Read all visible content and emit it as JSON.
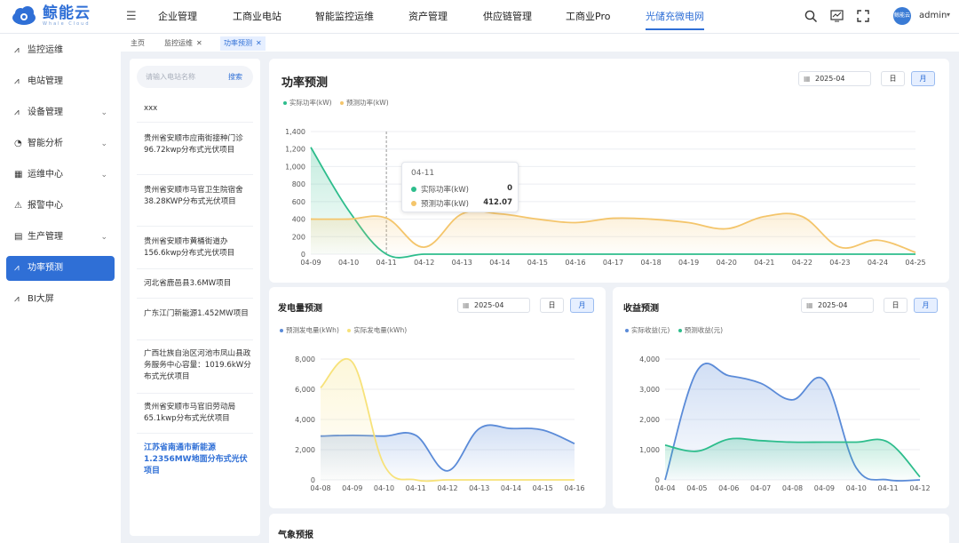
{
  "app": {
    "logo_text": "鲸能云",
    "logo_sub": "Whale Cloud"
  },
  "nav": {
    "items": [
      "企业管理",
      "工商业电站",
      "智能监控运维",
      "资产管理",
      "供应链管理",
      "工商业Pro",
      "光储充微电网"
    ],
    "active_index": 6
  },
  "header": {
    "user": "admin",
    "avatar_text": "鲸能云"
  },
  "sidebar": {
    "items": [
      {
        "label": "监控运维",
        "icon": "chart-line-icon",
        "expandable": false
      },
      {
        "label": "电站管理",
        "icon": "chart-line-icon",
        "expandable": false
      },
      {
        "label": "设备管理",
        "icon": "chart-line-icon",
        "expandable": true
      },
      {
        "label": "智能分析",
        "icon": "pie-chart-icon",
        "expandable": true
      },
      {
        "label": "运维中心",
        "icon": "grid-icon",
        "expandable": true
      },
      {
        "label": "报警中心",
        "icon": "warning-icon",
        "expandable": false
      },
      {
        "label": "生产管理",
        "icon": "calendar-icon",
        "expandable": true
      },
      {
        "label": "功率预测",
        "icon": "chart-line-icon",
        "expandable": false
      },
      {
        "label": "BI大屏",
        "icon": "chart-line-icon",
        "expandable": false
      }
    ],
    "active_index": 7
  },
  "tabs": [
    {
      "label": "主页",
      "closable": false
    },
    {
      "label": "监控运维",
      "closable": true
    },
    {
      "label": "功率预测",
      "closable": true,
      "active": true
    }
  ],
  "search": {
    "placeholder": "请输入电站名称",
    "button": "搜索",
    "value": ""
  },
  "stations": [
    "xxx",
    "贵州省安顺市应南街接种门诊96.72kwp分布式光伏项目",
    "贵州省安顺市马官卫生院宿舍38.28KWP分布式光伏项目",
    "贵州省安顺市黄桶街道办156.6kwp分布式光伏项目",
    "河北省鹿邑县3.6MW项目",
    "广东江门新能源1.452MW项目",
    "广西壮族自治区河池市凤山县政务服务中心容量：1019.6kW分布式光伏项目",
    "贵州省安顺市马官旧劳动局65.1kwp分布式光伏项目",
    "江苏省南通市新能源1.2356MW地面分布式光伏项目"
  ],
  "selected_station_index": 8,
  "toggle": {
    "day": "日",
    "month": "月"
  },
  "power_card": {
    "title": "功率预测",
    "date": "2025-04",
    "legend": [
      "实际功率(kW)",
      "预测功率(kW)"
    ],
    "tooltip": {
      "date": "04-11",
      "rows": [
        {
          "label": "实际功率(kW)",
          "value": "0"
        },
        {
          "label": "预测功率(kW)",
          "value": "412.07"
        }
      ]
    }
  },
  "gen_card": {
    "title": "发电量预测",
    "date": "2025-04",
    "legend": [
      "预测发电量(kWh)",
      "实际发电量(kWh)"
    ]
  },
  "rev_card": {
    "title": "收益预测",
    "date": "2025-04",
    "legend": [
      "实际收益(元)",
      "预测收益(元)"
    ]
  },
  "weather_card": {
    "title": "气象预报"
  },
  "colors": {
    "accent": "#2f6fd6",
    "green": "#2dbd8c",
    "orange": "#f4c56b",
    "blue": "#5b8bd8",
    "yellow": "#f7e27a"
  },
  "chart_data": [
    {
      "type": "line",
      "title": "功率预测",
      "x": [
        "04-09",
        "04-10",
        "04-11",
        "04-12",
        "04-13",
        "04-14",
        "04-15",
        "04-16",
        "04-17",
        "04-18",
        "04-19",
        "04-20",
        "04-21",
        "04-22",
        "04-23",
        "04-24",
        "04-25"
      ],
      "xlabel": "",
      "ylabel": "",
      "ylim": [
        0,
        1400
      ],
      "yticks": [
        0,
        200,
        400,
        600,
        800,
        1000,
        1200,
        1400
      ],
      "series": [
        {
          "name": "实际功率(kW)",
          "color": "#2dbd8c",
          "values": [
            1220,
            500,
            0,
            0,
            0,
            0,
            0,
            0,
            0,
            0,
            0,
            0,
            0,
            0,
            0,
            0,
            0
          ]
        },
        {
          "name": "预测功率(kW)",
          "color": "#f4c56b",
          "values": [
            400,
            400,
            412.07,
            80,
            460,
            460,
            400,
            360,
            410,
            400,
            360,
            290,
            430,
            430,
            80,
            160,
            20
          ]
        }
      ]
    },
    {
      "type": "area",
      "title": "发电量预测",
      "x": [
        "04-08",
        "04-09",
        "04-10",
        "04-11",
        "04-12",
        "04-13",
        "04-14",
        "04-15",
        "04-16"
      ],
      "ylim": [
        0,
        8000
      ],
      "yticks": [
        0,
        2000,
        4000,
        6000,
        8000
      ],
      "series": [
        {
          "name": "预测发电量(kWh)",
          "color": "#5b8bd8",
          "values": [
            2900,
            2950,
            2900,
            2950,
            600,
            3400,
            3400,
            3300,
            2400
          ]
        },
        {
          "name": "实际发电量(kWh)",
          "color": "#f7e27a",
          "values": [
            6100,
            7800,
            1000,
            0,
            0,
            0,
            0,
            0,
            0
          ]
        }
      ]
    },
    {
      "type": "area",
      "title": "收益预测",
      "x": [
        "04-04",
        "04-05",
        "04-06",
        "04-07",
        "04-08",
        "04-09",
        "04-10",
        "04-11",
        "04-12"
      ],
      "ylim": [
        0,
        4000
      ],
      "yticks": [
        0,
        1000,
        2000,
        3000,
        4000
      ],
      "series": [
        {
          "name": "实际收益(元)",
          "color": "#5b8bd8",
          "values": [
            0,
            3600,
            3450,
            3200,
            2650,
            3300,
            400,
            0,
            0
          ]
        },
        {
          "name": "预测收益(元)",
          "color": "#2dbd8c",
          "values": [
            1150,
            950,
            1350,
            1300,
            1250,
            1250,
            1250,
            1250,
            100
          ]
        }
      ]
    }
  ]
}
